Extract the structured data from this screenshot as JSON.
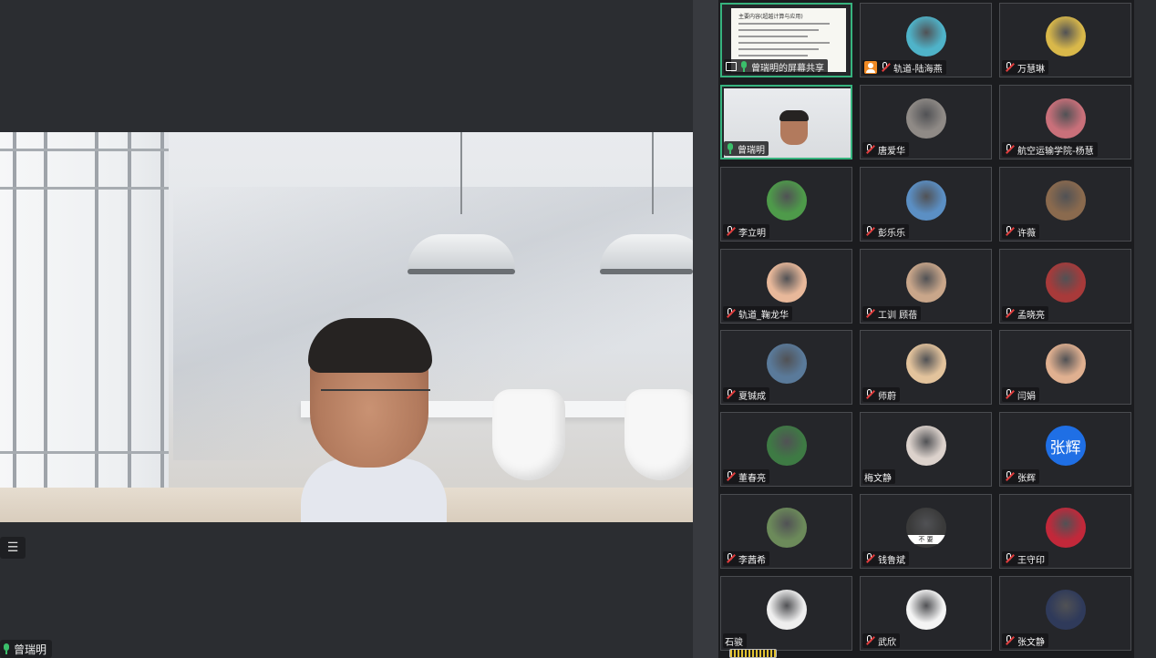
{
  "main": {
    "speaker_name": "曾瑞明",
    "list_toggle_glyph": "☰"
  },
  "gallery": {
    "tiles": [
      {
        "name": "曾瑞明的屏幕共享",
        "type": "screen-share",
        "mic": "on",
        "active": true,
        "share_title": "主要内容(超越计算与应用)"
      },
      {
        "name": "轨道-陆海燕",
        "type": "avatar",
        "mic": "muted",
        "host_badge": true,
        "avatar_color": "#4fb3c9"
      },
      {
        "name": "万慧琳",
        "type": "avatar",
        "mic": "muted",
        "avatar_color": "#d9b84a"
      },
      {
        "name": "曾瑞明",
        "type": "camera",
        "mic": "on",
        "active": true
      },
      {
        "name": "唐爱华",
        "type": "avatar",
        "mic": "muted",
        "avatar_color": "#8f8a86"
      },
      {
        "name": "航空运输学院-杨慧",
        "type": "avatar",
        "mic": "muted",
        "avatar_color": "#c9707a"
      },
      {
        "name": "李立明",
        "type": "avatar",
        "mic": "muted",
        "avatar_color": "#4e9a4a"
      },
      {
        "name": "彭乐乐",
        "type": "avatar",
        "mic": "muted",
        "avatar_color": "#5b8fc4"
      },
      {
        "name": "许薇",
        "type": "avatar",
        "mic": "muted",
        "avatar_color": "#8a6a4e"
      },
      {
        "name": "轨道_鞠龙华",
        "type": "avatar",
        "mic": "muted",
        "avatar_color": "#e8b89a"
      },
      {
        "name": "工训 顾蓓",
        "type": "avatar",
        "mic": "muted",
        "avatar_color": "#c9a68a"
      },
      {
        "name": "孟晓亮",
        "type": "avatar",
        "mic": "muted",
        "avatar_color": "#a83a3a"
      },
      {
        "name": "夏铖成",
        "type": "avatar",
        "mic": "muted",
        "avatar_color": "#5a7a9a"
      },
      {
        "name": "师蔚",
        "type": "avatar",
        "mic": "muted",
        "avatar_color": "#e3c39c"
      },
      {
        "name": "闫娟",
        "type": "avatar",
        "mic": "muted",
        "avatar_color": "#e0b090"
      },
      {
        "name": "董春亮",
        "type": "avatar",
        "mic": "muted",
        "avatar_color": "#3e7a44"
      },
      {
        "name": "梅文静",
        "type": "avatar",
        "mic": "none",
        "avatar_color": "#dcd2cc"
      },
      {
        "name": "张辉",
        "type": "text-avatar",
        "mic": "muted",
        "avatar_text": "张辉",
        "avatar_color": "#1f6fe5"
      },
      {
        "name": "李茜希",
        "type": "avatar",
        "mic": "muted",
        "avatar_color": "#6c8a5a"
      },
      {
        "name": "钱鲁斌",
        "type": "avatar",
        "mic": "muted",
        "avatar_color": "#3a3a3a",
        "avatar_caption": "不 要"
      },
      {
        "name": "王守印",
        "type": "avatar",
        "mic": "muted",
        "avatar_color": "#c2283a"
      },
      {
        "name": "石骏",
        "type": "avatar",
        "mic": "none",
        "avatar_color": "#eeeeee"
      },
      {
        "name": "武欣",
        "type": "avatar",
        "mic": "muted",
        "avatar_color": "#f4f4f4"
      },
      {
        "name": "张文静",
        "type": "avatar",
        "mic": "muted",
        "avatar_color": "#2f3a5a"
      }
    ]
  },
  "colors": {
    "active_border": "#36b37e",
    "muted_slash": "#e03c3c",
    "mic_on": "#3bbf6b",
    "host_badge": "#f08a24"
  }
}
